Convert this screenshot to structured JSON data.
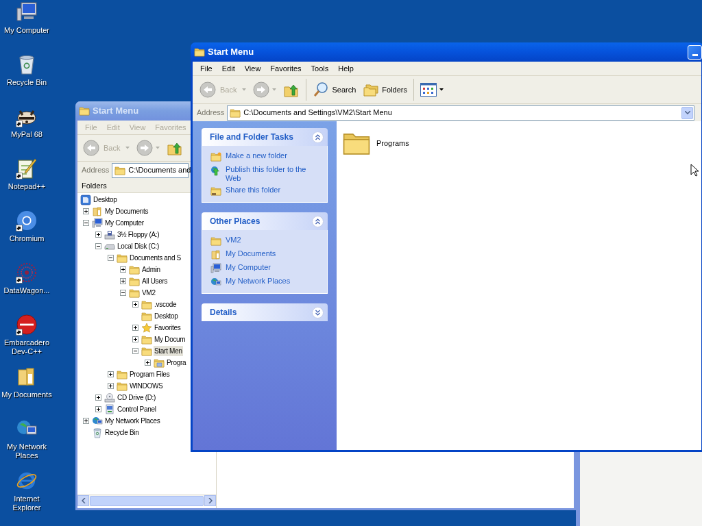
{
  "desktop_icons": [
    {
      "label": "My Computer",
      "kind": "computer",
      "shortcut": false
    },
    {
      "label": "Recycle Bin",
      "kind": "recycle",
      "shortcut": false
    },
    {
      "label": "MyPal 68",
      "kind": "raccoon",
      "shortcut": true
    },
    {
      "label": "Notepad++",
      "kind": "notepad",
      "shortcut": true
    },
    {
      "label": "Chromium",
      "kind": "ring",
      "shortcut": true
    },
    {
      "label": "DataWagon...",
      "kind": "starburst",
      "shortcut": true
    },
    {
      "label": "Embarcadero Dev-C++",
      "kind": "badge",
      "shortcut": true
    },
    {
      "label": "My Documents",
      "kind": "documents",
      "shortcut": false
    },
    {
      "label": "My Network Places",
      "kind": "network",
      "shortcut": false
    },
    {
      "label": "Internet Explorer",
      "kind": "ie",
      "shortcut": false
    }
  ],
  "back_window": {
    "title": "Start Menu",
    "active": false,
    "menu": [
      "File",
      "Edit",
      "View",
      "Favorites"
    ],
    "toolbar": [
      {
        "kind": "back",
        "label": "Back",
        "disabled": true
      },
      {
        "kind": "forward",
        "disabled": true
      },
      {
        "kind": "up",
        "disabled": false
      }
    ],
    "address": {
      "label": "Address",
      "value": "C:\\Documents and"
    },
    "folders_title": "Folders",
    "tree": [
      {
        "label": "Desktop",
        "kind": "desktop",
        "selected": false,
        "children": [
          {
            "label": "My Documents",
            "kind": "documents",
            "expanded": false,
            "selected": false
          },
          {
            "label": "My Computer",
            "kind": "computer",
            "expanded": true,
            "selected": false,
            "children": [
              {
                "label": "3½ Floppy (A:)",
                "kind": "floppy",
                "expanded": false,
                "selected": false
              },
              {
                "label": "Local Disk (C:)",
                "kind": "disk",
                "expanded": true,
                "selected": false,
                "children": [
                  {
                    "label": "Documents and S",
                    "kind": "folder",
                    "expanded": true,
                    "selected": false,
                    "children": [
                      {
                        "label": "Admin",
                        "kind": "folder",
                        "expanded": false,
                        "selected": false
                      },
                      {
                        "label": "All Users",
                        "kind": "folder",
                        "expanded": false,
                        "selected": false
                      },
                      {
                        "label": "VM2",
                        "kind": "folder",
                        "expanded": true,
                        "selected": false,
                        "children": [
                          {
                            "label": ".vscode",
                            "kind": "folder",
                            "expanded": false,
                            "selected": false
                          },
                          {
                            "label": "Desktop",
                            "kind": "folder",
                            "selected": false
                          },
                          {
                            "label": "Favorites",
                            "kind": "favorites",
                            "expanded": false,
                            "selected": false
                          },
                          {
                            "label": "My Docum",
                            "kind": "folder",
                            "expanded": false,
                            "selected": false
                          },
                          {
                            "label": "Start Men",
                            "kind": "folder",
                            "expanded": true,
                            "selected": true,
                            "children": [
                              {
                                "label": "Progra",
                                "kind": "programs",
                                "expanded": false,
                                "selected": false
                              }
                            ]
                          }
                        ]
                      }
                    ]
                  },
                  {
                    "label": "Program Files",
                    "kind": "folder",
                    "expanded": false,
                    "selected": false
                  },
                  {
                    "label": "WINDOWS",
                    "kind": "folder",
                    "expanded": false,
                    "selected": false
                  }
                ]
              },
              {
                "label": "CD Drive (D:)",
                "kind": "cdrom",
                "expanded": false,
                "selected": false
              },
              {
                "label": "Control Panel",
                "kind": "control",
                "expanded": false,
                "selected": false
              }
            ]
          },
          {
            "label": "My Network Places",
            "kind": "network",
            "expanded": false,
            "selected": false
          },
          {
            "label": "Recycle Bin",
            "kind": "recycle",
            "selected": false
          }
        ]
      }
    ]
  },
  "front_window": {
    "title": "Start Menu",
    "active": true,
    "menu": [
      "File",
      "Edit",
      "View",
      "Favorites",
      "Tools",
      "Help"
    ],
    "toolbar": [
      {
        "kind": "back",
        "label": "Back",
        "disabled": true
      },
      {
        "kind": "forward",
        "disabled": true
      },
      {
        "kind": "up",
        "disabled": false
      },
      {
        "kind": "separator"
      },
      {
        "kind": "search",
        "label": "Search",
        "disabled": false
      },
      {
        "kind": "folders",
        "label": "Folders",
        "disabled": false
      },
      {
        "kind": "separator"
      },
      {
        "kind": "views"
      }
    ],
    "address": {
      "label": "Address",
      "value": "C:\\Documents and Settings\\VM2\\Start Menu"
    },
    "task_sections": [
      {
        "title": "File and Folder Tasks",
        "expanded": true,
        "items": [
          {
            "label": "Make a new folder",
            "kind": "newfolder"
          },
          {
            "label": "Publish this folder to the Web",
            "kind": "publish"
          },
          {
            "label": "Share this folder",
            "kind": "share"
          }
        ]
      },
      {
        "title": "Other Places",
        "expanded": true,
        "items": [
          {
            "label": "VM2",
            "kind": "folder"
          },
          {
            "label": "My Documents",
            "kind": "documents"
          },
          {
            "label": "My Computer",
            "kind": "computer"
          },
          {
            "label": "My Network Places",
            "kind": "network"
          }
        ]
      },
      {
        "title": "Details",
        "expanded": false
      }
    ],
    "items": [
      {
        "label": "Programs",
        "kind": "folder"
      }
    ]
  }
}
